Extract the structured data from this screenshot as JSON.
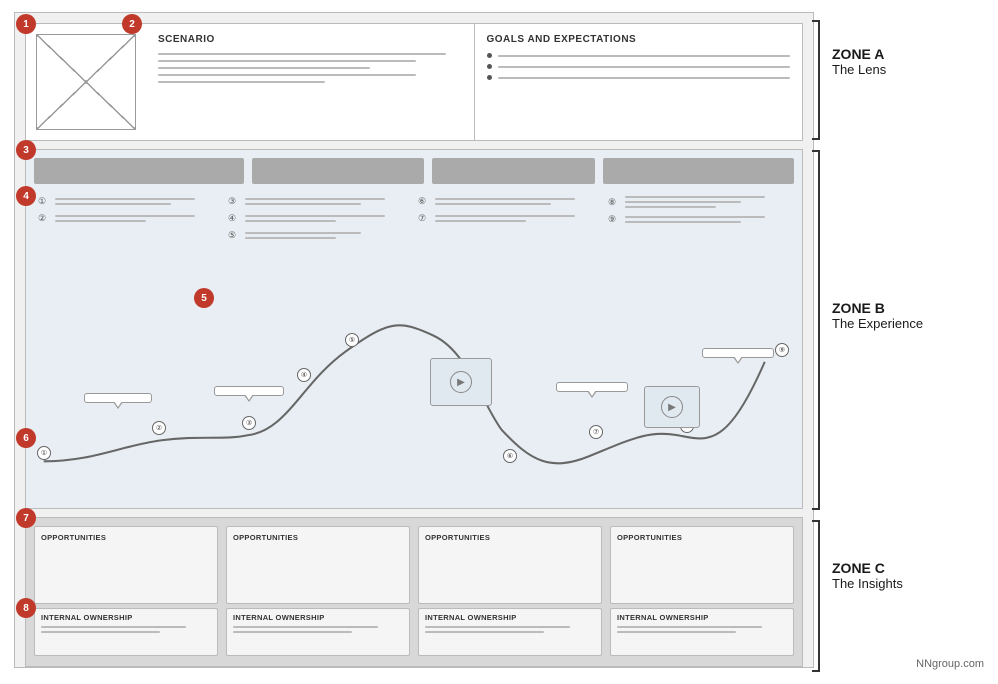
{
  "zones": {
    "a": {
      "label": "ZONE A",
      "sublabel": "The Lens",
      "scenario_title": "SCENARIO",
      "goals_title": "GOALS AND EXPECTATIONS"
    },
    "b": {
      "label": "ZONE B",
      "sublabel": "The Experience",
      "items": [
        [
          "①",
          "②"
        ],
        [
          "③",
          "④",
          "⑤"
        ],
        [
          "⑥",
          "⑦"
        ],
        [
          "⑧",
          "⑨"
        ]
      ]
    },
    "c": {
      "label": "ZONE C",
      "sublabel": "The Insights",
      "opportunities": [
        "OPPORTUNITIES",
        "OPPORTUNITIES",
        "OPPORTUNITIES",
        "OPPORTUNITIES"
      ],
      "ownership": [
        "INTERNAL OWNERSHIP",
        "INTERNAL OWNERSHIP",
        "INTERNAL OWNERSHIP",
        "INTERNAL OWNERSHIP"
      ]
    }
  },
  "numbered_labels": [
    "1",
    "2",
    "3",
    "4",
    "5",
    "6",
    "7",
    "8"
  ],
  "nngroup": "NNgroup.com"
}
